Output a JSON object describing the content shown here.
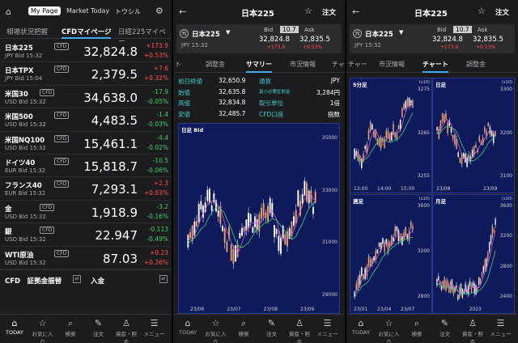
{
  "panel1": {
    "top_tabs": [
      "My Page",
      "Market Today",
      "トウシル"
    ],
    "sub_tabs": [
      "相場状況把握",
      "CFDマイページ",
      "日経225マイペー"
    ],
    "cfd_badge": "CFD",
    "rows": [
      {
        "name": "日本225",
        "sub": "JPY Bid 15:32",
        "price": "32,824.8",
        "change": "+173.9",
        "pct": "+0.53%",
        "dir": "up"
      },
      {
        "name": "日本TPX",
        "sub": "JPY Bid 15:04",
        "price": "2,379.5",
        "change": "+7.6",
        "pct": "+0.32%",
        "dir": "up"
      },
      {
        "name": "米国30",
        "sub": "USD Bid 15:32",
        "price": "34,638.0",
        "change": "-17.9",
        "pct": "-0.05%",
        "dir": "down"
      },
      {
        "name": "米国500",
        "sub": "USD Bid 15:32",
        "price": "4,483.5",
        "change": "-1.4",
        "pct": "-0.03%",
        "dir": "down"
      },
      {
        "name": "米国NQ100",
        "sub": "USD Bid 15:32",
        "price": "15,461.1",
        "change": "-4.4",
        "pct": "-0.02%",
        "dir": "down"
      },
      {
        "name": "ドイツ40",
        "sub": "EUR Bid 15:32",
        "price": "15,818.7",
        "change": "-10.5",
        "pct": "-0.06%",
        "dir": "down"
      },
      {
        "name": "フランス40",
        "sub": "EUR Bid 15:32",
        "price": "7,293.1",
        "change": "+2.3",
        "pct": "+0.03%",
        "dir": "up"
      },
      {
        "name": "金",
        "sub": "USD Bid 15:32",
        "price": "1,918.9",
        "change": "-3.2",
        "pct": "-0.16%",
        "dir": "down"
      },
      {
        "name": "銀",
        "sub": "USD Bid 15:32",
        "price": "22.947",
        "change": "-0.113",
        "pct": "-0.49%",
        "dir": "down"
      },
      {
        "name": "WTI原油",
        "sub": "USD Bid 15:32",
        "price": "87.03",
        "change": "+0.23",
        "pct": "+0.26%",
        "dir": "up"
      }
    ],
    "footer_left": "CFD　証拠金振替",
    "footer_right": "入金"
  },
  "nav": [
    "TODAY",
    "お気に入り",
    "検索",
    "注文",
    "資産・照会",
    "メニュー"
  ],
  "detail": {
    "title": "日本225",
    "order": "注文",
    "instrument": "日本225",
    "currency_time": "JPY 15:32",
    "bid_label": "Bid",
    "spread": "10.7",
    "ask_label": "Ask",
    "bid": "32,824.8",
    "ask": "32,835.5",
    "change": "+173.9",
    "pct": "+0.53%"
  },
  "panel2": {
    "sub_tabs": [
      "ト",
      "調整金",
      "サマリー",
      "市況情報",
      "チャ"
    ],
    "summary_left": [
      {
        "label": "前日終値",
        "value": "32,650.9"
      },
      {
        "label": "始値",
        "value": "32,635.8"
      },
      {
        "label": "高値",
        "value": "32,834.8"
      },
      {
        "label": "安値",
        "value": "32,485.7"
      }
    ],
    "summary_right": [
      {
        "label": "通貨",
        "value": "JPY"
      },
      {
        "label": "最小必要証拠金",
        "value": "3,284円"
      },
      {
        "label": "取引単位",
        "value": "1倍"
      },
      {
        "label": "CFD口座",
        "value": "指数"
      }
    ],
    "chart_label": "日足 Bid",
    "y_ticks": [
      "35000",
      "33000",
      "31000",
      "29000"
    ],
    "x_ticks": [
      "23/06",
      "23/07",
      "23/08",
      "23/09"
    ]
  },
  "panel3": {
    "sub_tabs": [
      "チャー",
      "市況情報",
      "チャート",
      "調整金"
    ],
    "charts": [
      {
        "label": "5分足",
        "unit": "(x10)",
        "y_ticks": [
          "3275",
          "3265",
          "3255"
        ],
        "x_ticks": [
          "13:00",
          "14:00",
          "15:00"
        ]
      },
      {
        "label": "日足",
        "unit": "(x10)",
        "y_ticks": [
          "3300",
          "3200",
          "3100"
        ],
        "x_ticks": [
          "23/08",
          "23/09"
        ]
      },
      {
        "label": "週足",
        "unit": "(x10)",
        "y_ticks": [
          "3600",
          "3200",
          "2800"
        ],
        "x_ticks": [
          "23/01",
          "23/04",
          "23/07"
        ]
      },
      {
        "label": "月足",
        "unit": "(x10)",
        "y_ticks": [
          "3600",
          "3200",
          "2800",
          "2400"
        ],
        "x_ticks": [
          "2023"
        ]
      }
    ]
  },
  "colors": {
    "up": "#ff4d4d",
    "down": "#3ad06a",
    "chart_bg": "#0f1a5c",
    "accent": "#3fa9f5"
  }
}
